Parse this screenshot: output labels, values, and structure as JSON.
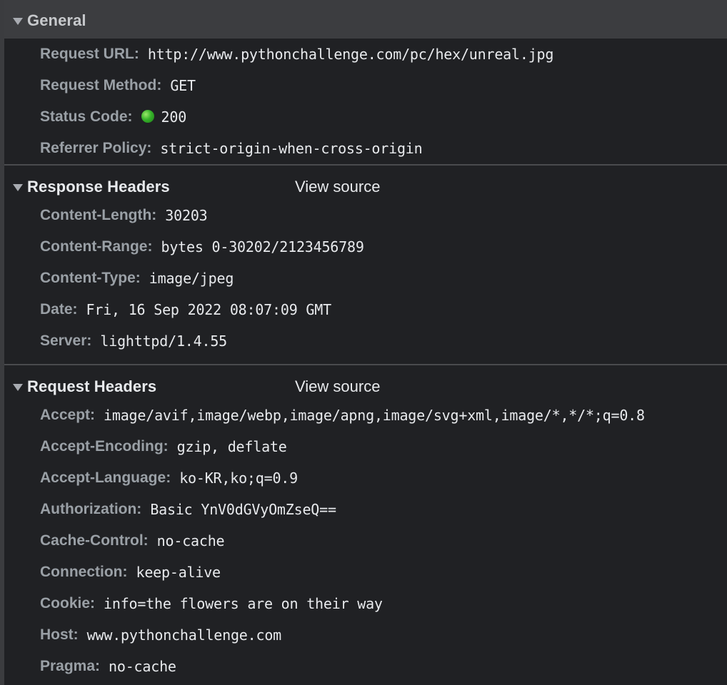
{
  "general": {
    "title": "General",
    "rows": [
      {
        "key": "Request URL:",
        "value": "http://www.pythonchallenge.com/pc/hex/unreal.jpg"
      },
      {
        "key": "Request Method:",
        "value": "GET"
      },
      {
        "key": "Status Code:",
        "value": "200",
        "status_color": "#36b32a"
      },
      {
        "key": "Referrer Policy:",
        "value": "strict-origin-when-cross-origin"
      }
    ]
  },
  "response_headers": {
    "title": "Response Headers",
    "view_source": "View source",
    "rows": [
      {
        "key": "Content-Length:",
        "value": "30203"
      },
      {
        "key": "Content-Range:",
        "value": "bytes 0-30202/2123456789"
      },
      {
        "key": "Content-Type:",
        "value": "image/jpeg"
      },
      {
        "key": "Date:",
        "value": "Fri, 16 Sep 2022 08:07:09 GMT"
      },
      {
        "key": "Server:",
        "value": "lighttpd/1.4.55"
      }
    ]
  },
  "request_headers": {
    "title": "Request Headers",
    "view_source": "View source",
    "rows": [
      {
        "key": "Accept:",
        "value": "image/avif,image/webp,image/apng,image/svg+xml,image/*,*/*;q=0.8"
      },
      {
        "key": "Accept-Encoding:",
        "value": "gzip, deflate"
      },
      {
        "key": "Accept-Language:",
        "value": "ko-KR,ko;q=0.9"
      },
      {
        "key": "Authorization:",
        "value": "Basic YnV0dGVyOmZseQ=="
      },
      {
        "key": "Cache-Control:",
        "value": "no-cache"
      },
      {
        "key": "Connection:",
        "value": "keep-alive"
      },
      {
        "key": "Cookie:",
        "value": "info=the flowers are on their way"
      },
      {
        "key": "Host:",
        "value": "www.pythonchallenge.com"
      },
      {
        "key": "Pragma:",
        "value": "no-cache"
      }
    ]
  },
  "icons": {
    "collapse": "triangle-down-icon",
    "status": "status-dot-icon"
  },
  "colors": {
    "background": "#202124",
    "header_background": "#3c3d40",
    "key_text": "#9aa0a6",
    "value_text": "#e8eaed",
    "status_ok": "#36b32a"
  }
}
